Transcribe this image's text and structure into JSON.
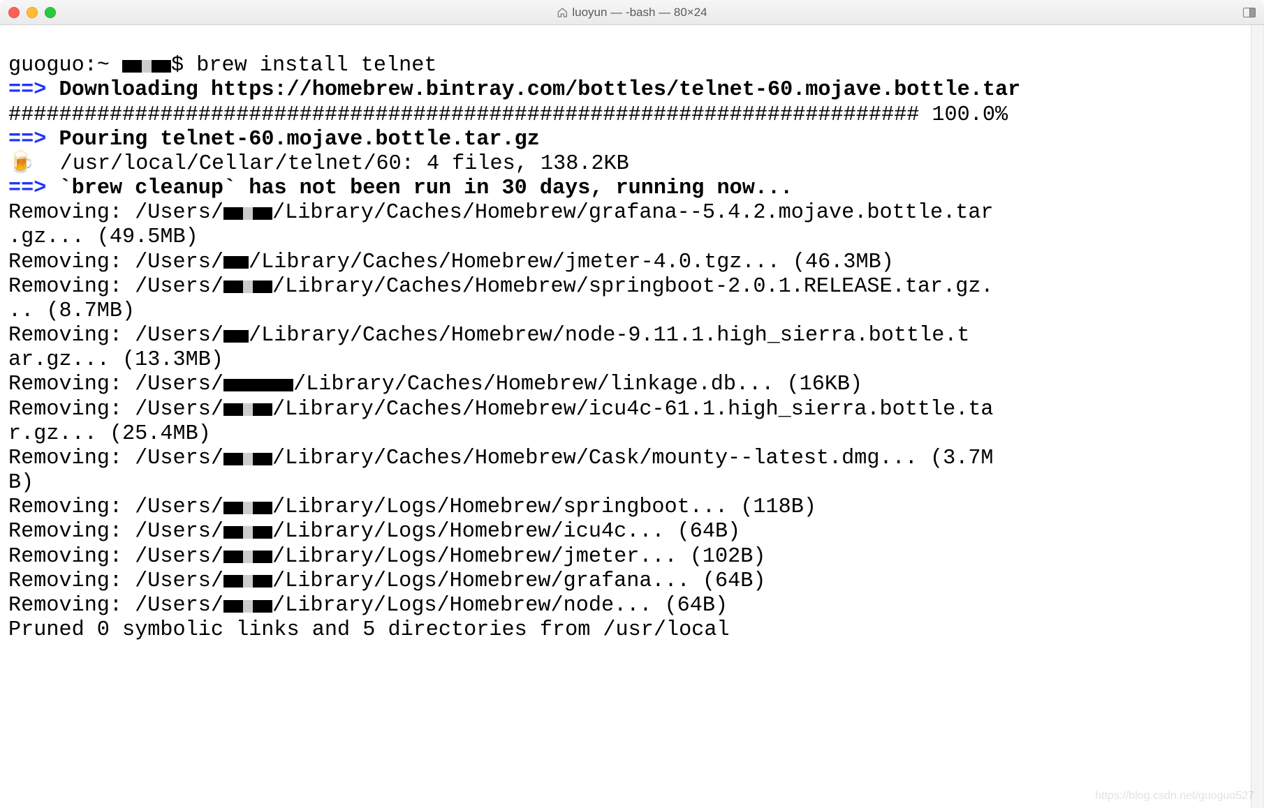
{
  "titlebar": {
    "title": "luoyun — -bash — 80×24"
  },
  "terminal": {
    "prompt_host": "guoguo:~ ",
    "prompt_tail": "$ ",
    "command": "brew install telnet",
    "arrow": "==>",
    "download_label": "Downloading https://homebrew.bintray.com/bottles/telnet-60.mojave.bottle.tar",
    "progress_bar": "######################################################################## 100.0%",
    "pouring_label": "Pouring telnet-60.mojave.bottle.tar.gz",
    "beer_emoji": "🍺",
    "cellar_line": "  /usr/local/Cellar/telnet/60: 4 files, 138.2KB",
    "cleanup_label": "`brew cleanup` has not been run in 30 days, running now...",
    "removing_prefix": "Removing: /Users/",
    "lines": {
      "grafana_a": "/Library/Caches/Homebrew/grafana--5.4.2.mojave.bottle.tar",
      "grafana_b": ".gz... (49.5MB)",
      "jmeter_tgz": "/Library/Caches/Homebrew/jmeter-4.0.tgz... (46.3MB)",
      "springboot_a": "/Library/Caches/Homebrew/springboot-2.0.1.RELEASE.tar.gz.",
      "springboot_b": ".. (8.7MB)",
      "node_a": "/Library/Caches/Homebrew/node-9.11.1.high_sierra.bottle.t",
      "node_b": "ar.gz... (13.3MB)",
      "linkage": "/Library/Caches/Homebrew/linkage.db... (16KB)",
      "icu4c_a": "/Library/Caches/Homebrew/icu4c-61.1.high_sierra.bottle.ta",
      "icu4c_b": "r.gz... (25.4MB)",
      "mounty_a": "/Library/Caches/Homebrew/Cask/mounty--latest.dmg... (3.7M",
      "mounty_b": "B)",
      "logs_springboot": "/Library/Logs/Homebrew/springboot... (118B)",
      "logs_icu4c": "/Library/Logs/Homebrew/icu4c... (64B)",
      "logs_jmeter": "/Library/Logs/Homebrew/jmeter... (102B)",
      "logs_grafana": "/Library/Logs/Homebrew/grafana... (64B)",
      "logs_node": "/Library/Logs/Homebrew/node... (64B)"
    },
    "pruned_line": "Pruned 0 symbolic links and 5 directories from /usr/local"
  },
  "watermark": "https://blog.csdn.net/guoguo527"
}
